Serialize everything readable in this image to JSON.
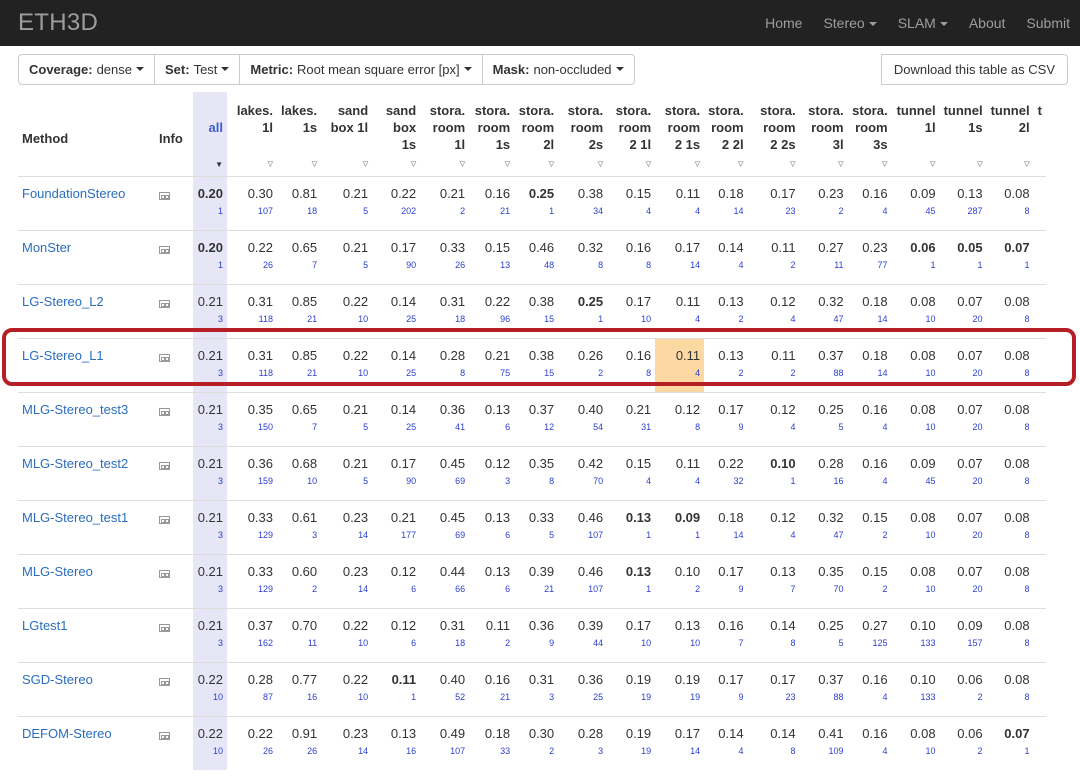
{
  "nav": {
    "brand": "ETH3D",
    "links": [
      "Home",
      "Stereo",
      "SLAM",
      "About",
      "Submit"
    ]
  },
  "toolbar": {
    "coverage_label": "Coverage:",
    "coverage_value": "dense",
    "set_label": "Set:",
    "set_value": "Test",
    "metric_label": "Metric:",
    "metric_value": "Root mean square error [px]",
    "mask_label": "Mask:",
    "mask_value": "non-occluded",
    "csv_button": "Download this table as CSV"
  },
  "table": {
    "method_header": "Method",
    "info_header": "Info",
    "columns": [
      {
        "l1": "",
        "l2": "all",
        "l3": ""
      },
      {
        "l1": "lakes.",
        "l2": "1l",
        "l3": ""
      },
      {
        "l1": "lakes.",
        "l2": "1s",
        "l3": ""
      },
      {
        "l1": "sand",
        "l2": "box 1l",
        "l3": ""
      },
      {
        "l1": "sand",
        "l2": "box",
        "l3": "1s"
      },
      {
        "l1": "stora.",
        "l2": "room",
        "l3": "1l"
      },
      {
        "l1": "stora.",
        "l2": "room",
        "l3": "1s"
      },
      {
        "l1": "stora.",
        "l2": "room",
        "l3": "2l"
      },
      {
        "l1": "stora.",
        "l2": "room",
        "l3": "2s"
      },
      {
        "l1": "stora.",
        "l2": "room",
        "l3": "2 1l"
      },
      {
        "l1": "stora.",
        "l2": "room",
        "l3": "2 1s"
      },
      {
        "l1": "stora.",
        "l2": "room",
        "l3": "2 2l"
      },
      {
        "l1": "stora.",
        "l2": "room",
        "l3": "2 2s"
      },
      {
        "l1": "stora.",
        "l2": "room",
        "l3": "3l"
      },
      {
        "l1": "stora.",
        "l2": "room",
        "l3": "3s"
      },
      {
        "l1": "tunnel",
        "l2": "1l",
        "l3": ""
      },
      {
        "l1": "tunnel",
        "l2": "1s",
        "l3": ""
      },
      {
        "l1": "tunnel",
        "l2": "2l",
        "l3": ""
      }
    ],
    "cut_header": "t",
    "rows": [
      {
        "method": "FoundationStereo",
        "vals": [
          "0.20",
          "0.30",
          "0.81",
          "0.21",
          "0.22",
          "0.21",
          "0.16",
          "0.25",
          "0.38",
          "0.15",
          "0.11",
          "0.18",
          "0.17",
          "0.23",
          "0.16",
          "0.09",
          "0.13",
          "0.08"
        ],
        "ranks": [
          "1",
          "107",
          "18",
          "5",
          "202",
          "2",
          "21",
          "1",
          "34",
          "4",
          "4",
          "14",
          "23",
          "2",
          "4",
          "45",
          "287",
          "8"
        ],
        "bold": [
          0,
          7
        ]
      },
      {
        "method": "MonSter",
        "vals": [
          "0.20",
          "0.22",
          "0.65",
          "0.21",
          "0.17",
          "0.33",
          "0.15",
          "0.46",
          "0.32",
          "0.16",
          "0.17",
          "0.14",
          "0.11",
          "0.27",
          "0.23",
          "0.06",
          "0.05",
          "0.07"
        ],
        "ranks": [
          "1",
          "26",
          "7",
          "5",
          "90",
          "26",
          "13",
          "48",
          "8",
          "8",
          "14",
          "4",
          "2",
          "11",
          "77",
          "1",
          "1",
          "1"
        ],
        "bold": [
          0,
          15,
          16,
          17
        ]
      },
      {
        "method": "LG-Stereo_L2",
        "vals": [
          "0.21",
          "0.31",
          "0.85",
          "0.22",
          "0.14",
          "0.31",
          "0.22",
          "0.38",
          "0.25",
          "0.17",
          "0.11",
          "0.13",
          "0.12",
          "0.32",
          "0.18",
          "0.08",
          "0.07",
          "0.08"
        ],
        "ranks": [
          "3",
          "118",
          "21",
          "10",
          "25",
          "18",
          "96",
          "15",
          "1",
          "10",
          "4",
          "2",
          "4",
          "47",
          "14",
          "10",
          "20",
          "8"
        ],
        "bold": [
          8
        ]
      },
      {
        "method": "LG-Stereo_L1",
        "vals": [
          "0.21",
          "0.31",
          "0.85",
          "0.22",
          "0.14",
          "0.28",
          "0.21",
          "0.38",
          "0.26",
          "0.16",
          "0.11",
          "0.13",
          "0.11",
          "0.37",
          "0.18",
          "0.08",
          "0.07",
          "0.08"
        ],
        "ranks": [
          "3",
          "118",
          "21",
          "10",
          "25",
          "8",
          "75",
          "15",
          "2",
          "8",
          "4",
          "2",
          "2",
          "88",
          "14",
          "10",
          "20",
          "8"
        ],
        "bold": [],
        "highlight": 10
      },
      {
        "method": "MLG-Stereo_test3",
        "vals": [
          "0.21",
          "0.35",
          "0.65",
          "0.21",
          "0.14",
          "0.36",
          "0.13",
          "0.37",
          "0.40",
          "0.21",
          "0.12",
          "0.17",
          "0.12",
          "0.25",
          "0.16",
          "0.08",
          "0.07",
          "0.08"
        ],
        "ranks": [
          "3",
          "150",
          "7",
          "5",
          "25",
          "41",
          "6",
          "12",
          "54",
          "31",
          "8",
          "9",
          "4",
          "5",
          "4",
          "10",
          "20",
          "8"
        ],
        "bold": []
      },
      {
        "method": "MLG-Stereo_test2",
        "vals": [
          "0.21",
          "0.36",
          "0.68",
          "0.21",
          "0.17",
          "0.45",
          "0.12",
          "0.35",
          "0.42",
          "0.15",
          "0.11",
          "0.22",
          "0.10",
          "0.28",
          "0.16",
          "0.09",
          "0.07",
          "0.08"
        ],
        "ranks": [
          "3",
          "159",
          "10",
          "5",
          "90",
          "69",
          "3",
          "8",
          "70",
          "4",
          "4",
          "32",
          "1",
          "16",
          "4",
          "45",
          "20",
          "8"
        ],
        "bold": [
          12
        ]
      },
      {
        "method": "MLG-Stereo_test1",
        "vals": [
          "0.21",
          "0.33",
          "0.61",
          "0.23",
          "0.21",
          "0.45",
          "0.13",
          "0.33",
          "0.46",
          "0.13",
          "0.09",
          "0.18",
          "0.12",
          "0.32",
          "0.15",
          "0.08",
          "0.07",
          "0.08"
        ],
        "ranks": [
          "3",
          "129",
          "3",
          "14",
          "177",
          "69",
          "6",
          "5",
          "107",
          "1",
          "1",
          "14",
          "4",
          "47",
          "2",
          "10",
          "20",
          "8"
        ],
        "bold": [
          9,
          10
        ]
      },
      {
        "method": "MLG-Stereo",
        "vals": [
          "0.21",
          "0.33",
          "0.60",
          "0.23",
          "0.12",
          "0.44",
          "0.13",
          "0.39",
          "0.46",
          "0.13",
          "0.10",
          "0.17",
          "0.13",
          "0.35",
          "0.15",
          "0.08",
          "0.07",
          "0.08"
        ],
        "ranks": [
          "3",
          "129",
          "2",
          "14",
          "6",
          "66",
          "6",
          "21",
          "107",
          "1",
          "2",
          "9",
          "7",
          "70",
          "2",
          "10",
          "20",
          "8"
        ],
        "bold": [
          9
        ]
      },
      {
        "method": "LGtest1",
        "vals": [
          "0.21",
          "0.37",
          "0.70",
          "0.22",
          "0.12",
          "0.31",
          "0.11",
          "0.36",
          "0.39",
          "0.17",
          "0.13",
          "0.16",
          "0.14",
          "0.25",
          "0.27",
          "0.10",
          "0.09",
          "0.08"
        ],
        "ranks": [
          "3",
          "162",
          "11",
          "10",
          "6",
          "18",
          "2",
          "9",
          "44",
          "10",
          "10",
          "7",
          "8",
          "5",
          "125",
          "133",
          "157",
          "8"
        ],
        "bold": []
      },
      {
        "method": "SGD-Stereo",
        "vals": [
          "0.22",
          "0.28",
          "0.77",
          "0.22",
          "0.11",
          "0.40",
          "0.16",
          "0.31",
          "0.36",
          "0.19",
          "0.19",
          "0.17",
          "0.17",
          "0.37",
          "0.16",
          "0.10",
          "0.06",
          "0.08"
        ],
        "ranks": [
          "10",
          "87",
          "16",
          "10",
          "1",
          "52",
          "21",
          "3",
          "25",
          "19",
          "19",
          "9",
          "23",
          "88",
          "4",
          "133",
          "2",
          "8"
        ],
        "bold": [
          4
        ]
      },
      {
        "method": "DEFOM-Stereo",
        "vals": [
          "0.22",
          "0.22",
          "0.91",
          "0.23",
          "0.13",
          "0.49",
          "0.18",
          "0.30",
          "0.28",
          "0.19",
          "0.17",
          "0.14",
          "0.14",
          "0.41",
          "0.16",
          "0.08",
          "0.06",
          "0.07"
        ],
        "ranks": [
          "10",
          "26",
          "26",
          "14",
          "16",
          "107",
          "33",
          "2",
          "3",
          "19",
          "14",
          "4",
          "8",
          "109",
          "4",
          "10",
          "2",
          "1"
        ],
        "bold": [
          17
        ]
      }
    ]
  }
}
